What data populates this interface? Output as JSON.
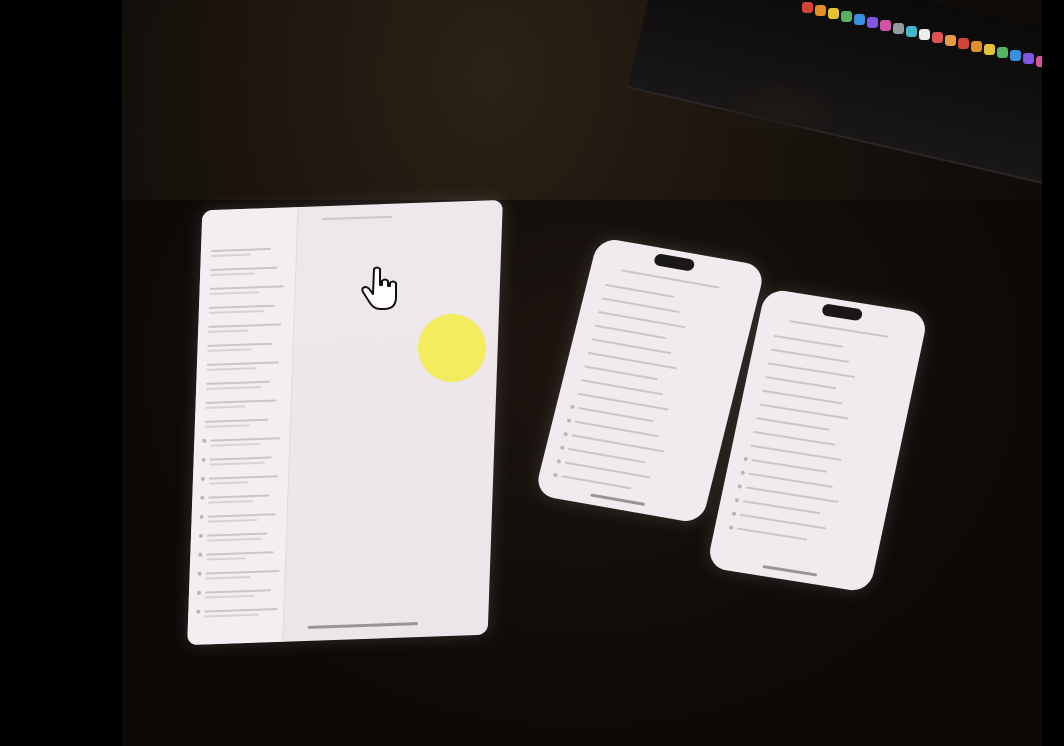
{
  "scene": {
    "background_color": "#000000",
    "highlight_color": "#f2ee52"
  },
  "tablet": {
    "sidebar_rows": 20,
    "content": []
  },
  "phones": [
    {
      "rows": 15
    },
    {
      "rows": 15
    }
  ],
  "pointer": {
    "icon": "hand-cursor-icon"
  }
}
